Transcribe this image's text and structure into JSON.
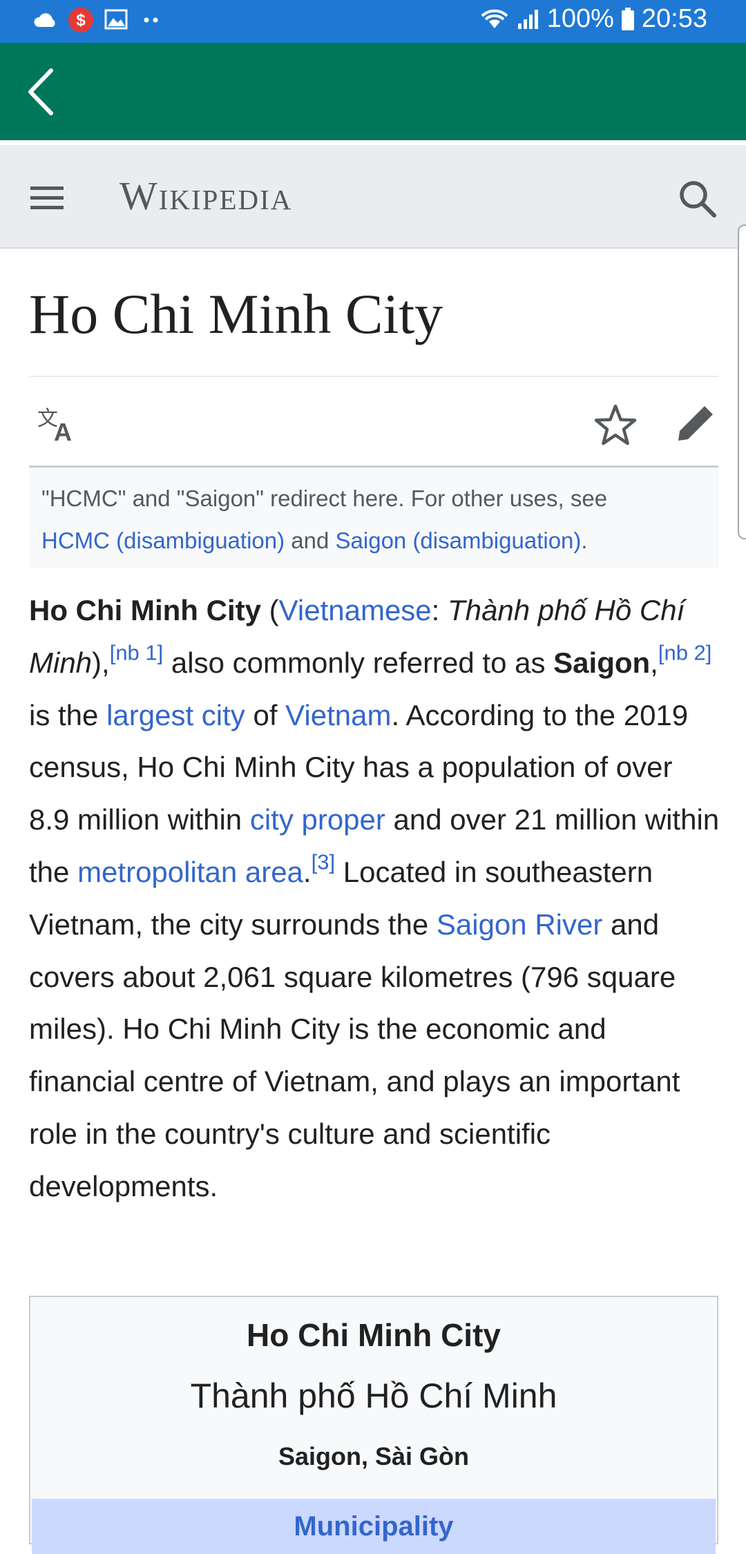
{
  "status_bar": {
    "battery": "100%",
    "time": "20:53",
    "icons": [
      "cloud-icon",
      "s-notification-icon",
      "gallery-icon",
      "more-dots-icon",
      "wifi-icon",
      "signal-icon",
      "battery-icon"
    ]
  },
  "app_bar": {
    "back_icon": "back-arrow-icon"
  },
  "header": {
    "wordmark": "Wikipedia",
    "menu_icon": "menu-icon",
    "search_icon": "search-icon"
  },
  "article": {
    "title": "Ho Chi Minh City",
    "actions": [
      "language-icon",
      "star-icon",
      "pencil-icon"
    ],
    "hatnote": {
      "prefix": "\"HCMC\" and \"Saigon\" redirect here. For other uses, see",
      "link1": "HCMC (disambiguation)",
      "and": "and",
      "link2": "Saigon (disambiguation)",
      "end": "."
    },
    "lead": {
      "b1": "Ho Chi Minh City",
      "t1": " (",
      "l1": "Vietnamese",
      "t2": ": ",
      "i1": "Thành phố Hồ Chí Minh",
      "t3": "),",
      "sup1": "[nb 1]",
      "t4": " also commonly referred to as ",
      "b2": "Saigon",
      "t5": ",",
      "sup2": "[nb 2]",
      "t6": " is the ",
      "l2": "largest city",
      "t7": " of ",
      "l3": "Vietnam",
      "t8": ". According to the 2019 census, Ho Chi Minh City has a population of over 8.9 million within ",
      "l4": "city proper",
      "t9": " and over 21 million within the ",
      "l5": "metropolitan area",
      "t10": ".",
      "sup3": "[3]",
      "t11": " Located in southeastern Vietnam, the city surrounds the ",
      "l6": "Saigon River",
      "t12": " and covers about 2,061 square kilometres (796 square miles). Ho Chi Minh City is the economic and financial centre of Vietnam, and plays an important role in the country's culture and scientific developments."
    },
    "infobox": {
      "title": "Ho Chi Minh City",
      "native_name": "Thành phố Hồ Chí Minh",
      "nicknames": "Saigon, Sài Gòn",
      "type_header": "Municipality"
    }
  }
}
